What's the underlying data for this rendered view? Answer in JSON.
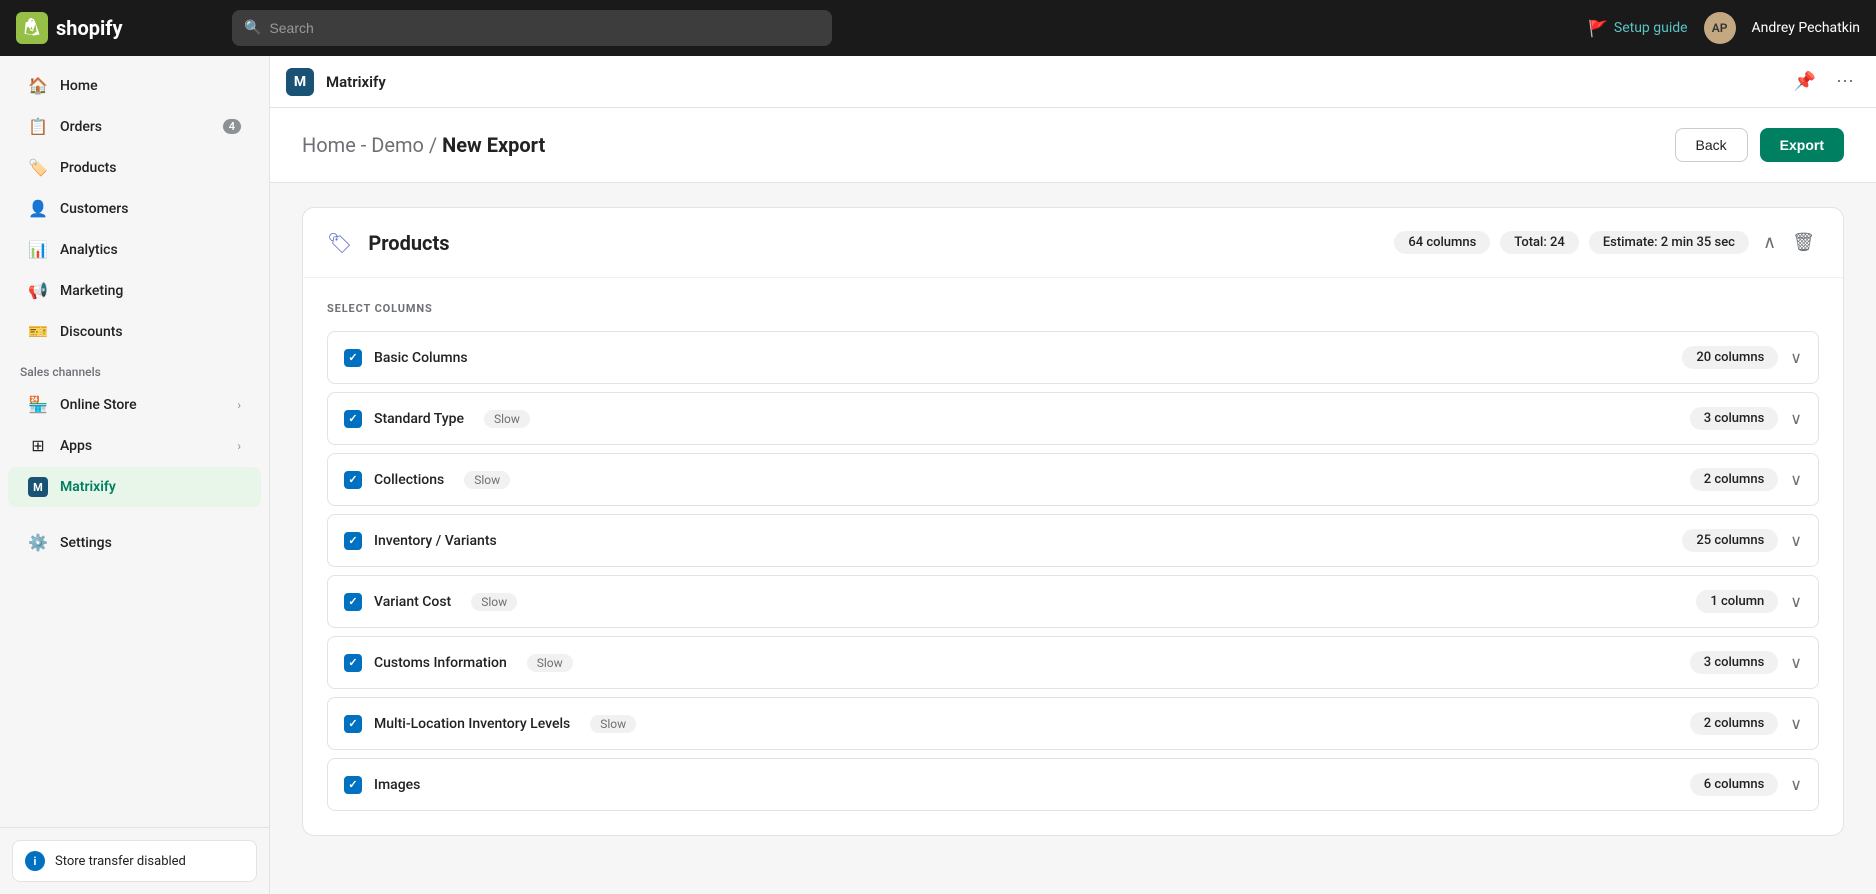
{
  "header": {
    "logo_text": "shopify",
    "search_placeholder": "Search",
    "setup_guide_label": "Setup guide",
    "user_initials": "AP",
    "user_name": "Andrey Pechatkin"
  },
  "sidebar": {
    "nav_items": [
      {
        "id": "home",
        "label": "Home",
        "icon": "🏠",
        "badge": null
      },
      {
        "id": "orders",
        "label": "Orders",
        "icon": "📋",
        "badge": "4"
      },
      {
        "id": "products",
        "label": "Products",
        "icon": "🏷️",
        "badge": null
      },
      {
        "id": "customers",
        "label": "Customers",
        "icon": "👤",
        "badge": null
      },
      {
        "id": "analytics",
        "label": "Analytics",
        "icon": "📊",
        "badge": null
      },
      {
        "id": "marketing",
        "label": "Marketing",
        "icon": "📢",
        "badge": null
      },
      {
        "id": "discounts",
        "label": "Discounts",
        "icon": "🎫",
        "badge": null
      }
    ],
    "sales_channels_label": "Sales channels",
    "sales_channels": [
      {
        "id": "online-store",
        "label": "Online Store",
        "icon": "🏪"
      }
    ],
    "apps_label": "Apps",
    "apps_chevron": "›",
    "app_items": [
      {
        "id": "matrixify",
        "label": "Matrixify",
        "icon": "M",
        "active": true
      }
    ],
    "settings_label": "Settings",
    "store_transfer_label": "Store transfer disabled"
  },
  "app_bar": {
    "logo_text": "M",
    "app_name": "Matrixify",
    "pin_icon": "📌",
    "more_icon": "⋯"
  },
  "page_header": {
    "breadcrumb": "Home - Demo / ",
    "current_page": "New Export",
    "back_button": "Back",
    "export_button": "Export"
  },
  "export_section": {
    "icon": "🏷",
    "title": "Products",
    "columns_count": "64 columns",
    "total_label": "Total: 24",
    "estimate_label": "Estimate: 2 min 35 sec",
    "select_columns_label": "SELECT COLUMNS",
    "columns": [
      {
        "id": "basic-columns",
        "label": "Basic Columns",
        "slow": false,
        "count": "20 columns",
        "checked": true
      },
      {
        "id": "standard-type",
        "label": "Standard Type",
        "slow": true,
        "count": "3 columns",
        "checked": true
      },
      {
        "id": "collections",
        "label": "Collections",
        "slow": true,
        "count": "2 columns",
        "checked": true
      },
      {
        "id": "inventory-variants",
        "label": "Inventory / Variants",
        "slow": false,
        "count": "25 columns",
        "checked": true
      },
      {
        "id": "variant-cost",
        "label": "Variant Cost",
        "slow": true,
        "count": "1 column",
        "checked": true
      },
      {
        "id": "customs-information",
        "label": "Customs Information",
        "slow": true,
        "count": "3 columns",
        "checked": true
      },
      {
        "id": "multi-location",
        "label": "Multi-Location Inventory Levels",
        "slow": true,
        "count": "2 columns",
        "checked": true
      },
      {
        "id": "images",
        "label": "Images",
        "slow": false,
        "count": "6 columns",
        "checked": true
      }
    ],
    "slow_badge_text": "Slow"
  }
}
